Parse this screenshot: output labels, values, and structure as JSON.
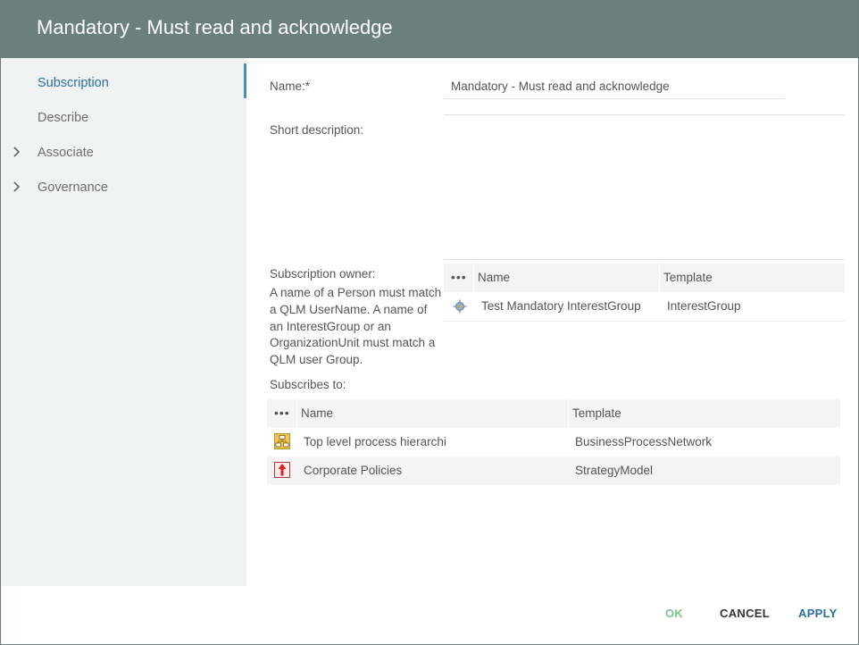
{
  "dialog": {
    "title": "Mandatory - Must read and acknowledge"
  },
  "sidebar": {
    "items": [
      {
        "label": "Subscription"
      },
      {
        "label": "Describe"
      },
      {
        "label": "Associate"
      },
      {
        "label": "Governance"
      }
    ]
  },
  "form": {
    "name_label": "Name:*",
    "name_value": "Mandatory - Must read and acknowledge",
    "short_description_label": "Short description:",
    "short_description_value": "",
    "owner_label": "Subscription owner:",
    "owner_help": "A name of a Person must match a QLM UserName. A name of an InterestGroup or an OrganizationUnit must match a QLM user Group.",
    "subscribes_label": "Subscribes to:"
  },
  "owner_grid": {
    "menu_glyph": "•••",
    "columns": [
      "Name",
      "Template"
    ],
    "rows": [
      {
        "icon": "interest-group-icon",
        "name": "Test Mandatory InterestGroup",
        "template": "InterestGroup"
      }
    ]
  },
  "subscribes_grid": {
    "menu_glyph": "•••",
    "columns": [
      "Name",
      "Template"
    ],
    "rows": [
      {
        "icon": "process-network-icon",
        "name": "Top level process hierarchi",
        "template": "BusinessProcessNetwork"
      },
      {
        "icon": "strategy-model-icon",
        "name": "Corporate Policies",
        "template": "StrategyModel"
      }
    ]
  },
  "footer": {
    "ok": "OK",
    "cancel": "CANCEL",
    "apply": "APPLY"
  },
  "colors": {
    "header_bg": "#6b807d",
    "accent": "#2a6fa0",
    "ok_text": "#7cc48b",
    "sidebar_bg": "#f1f2f2"
  }
}
